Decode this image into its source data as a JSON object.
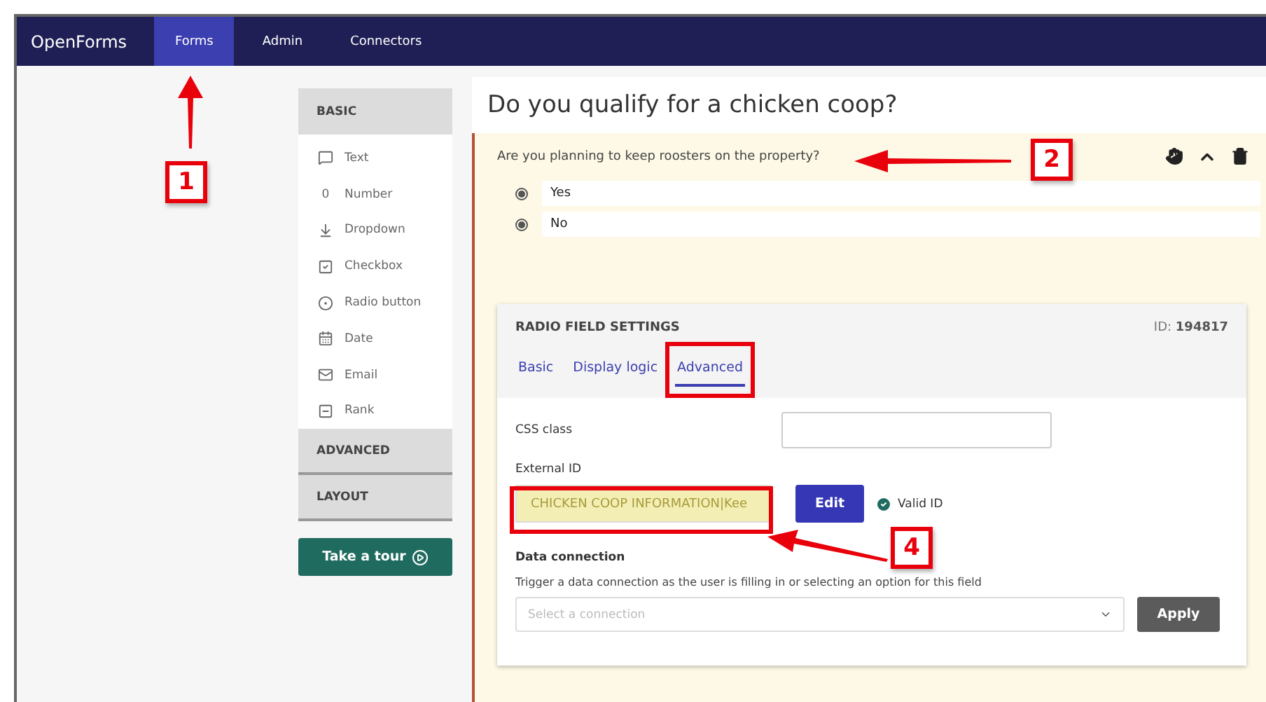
{
  "topbar": {
    "logo": "OpenForms",
    "nav": [
      {
        "label": "Forms",
        "selected": true
      },
      {
        "label": "Admin",
        "selected": false
      },
      {
        "label": "Connectors",
        "selected": false
      }
    ]
  },
  "palette": {
    "sections": [
      {
        "title": "BASIC",
        "expanded": true,
        "items": [
          {
            "label": "Text"
          },
          {
            "label": "Number",
            "glyph": "0"
          },
          {
            "label": "Dropdown"
          },
          {
            "label": "Checkbox"
          },
          {
            "label": "Radio button"
          },
          {
            "label": "Date"
          },
          {
            "label": "Email"
          },
          {
            "label": "Rank"
          }
        ]
      },
      {
        "title": "ADVANCED",
        "expanded": false
      },
      {
        "title": "LAYOUT",
        "expanded": false
      }
    ],
    "tour_button": "Take a tour"
  },
  "form": {
    "title": "Do you qualify for a chicken coop?",
    "question": {
      "label": "Are you planning to keep roosters on the property?",
      "options": [
        {
          "label": "Yes",
          "selected": true
        },
        {
          "label": "No",
          "selected": true
        }
      ]
    },
    "settings": {
      "title": "RADIO FIELD SETTINGS",
      "id_label": "ID:",
      "id_value": "194817",
      "tabs": [
        {
          "label": "Basic",
          "selected": false
        },
        {
          "label": "Display logic",
          "selected": false
        },
        {
          "label": "Advanced",
          "selected": true
        }
      ],
      "css_class_label": "CSS class",
      "external_id_label": "External ID",
      "external_id_value": "CHICKEN COOP INFORMATION|Kee",
      "edit_button": "Edit",
      "valid_label": "Valid ID",
      "data_connection_label": "Data connection",
      "data_connection_help": "Trigger a data connection as the user is filling in or selecting an option for this field",
      "select_placeholder": "Select a connection",
      "apply_button": "Apply"
    }
  },
  "annotations": [
    {
      "number": "1"
    },
    {
      "number": "2"
    },
    {
      "number": "4"
    }
  ]
}
